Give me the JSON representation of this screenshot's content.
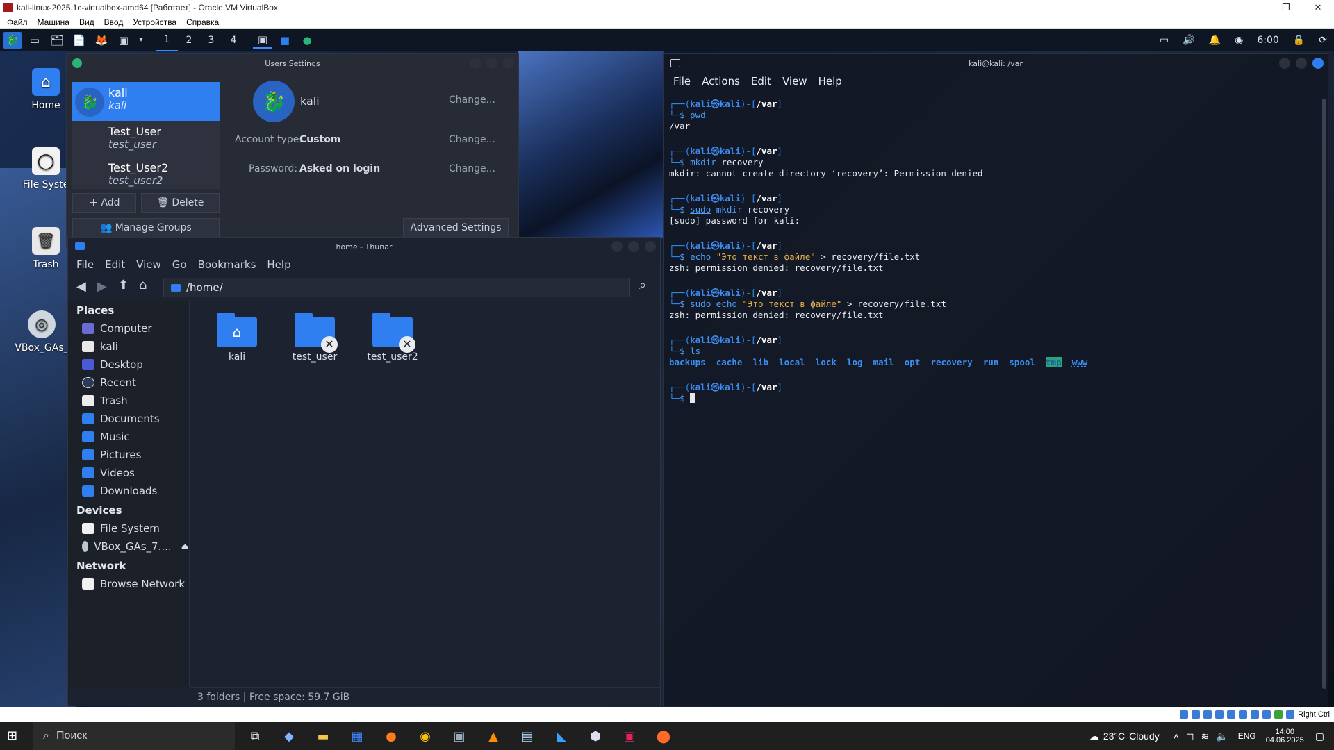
{
  "host": {
    "title": "kali-linux-2025.1c-virtualbox-amd64 [Работает] - Oracle VM VirtualBox",
    "menu": [
      "Файл",
      "Машина",
      "Вид",
      "Ввод",
      "Устройства",
      "Справка"
    ],
    "window_controls": [
      "—",
      "❐",
      "✕"
    ],
    "status_right": "Right Ctrl"
  },
  "panel": {
    "workspaces": [
      "1",
      "2",
      "3",
      "4"
    ],
    "clock": "6:00"
  },
  "desktop": {
    "icons": [
      "Home",
      "File Syste",
      "Trash",
      "VBox_GAs_"
    ]
  },
  "users": {
    "title": "Users Settings",
    "list": [
      {
        "name": "kali",
        "login": "kali"
      },
      {
        "name": "Test_User",
        "login": "test_user"
      },
      {
        "name": "Test_User2",
        "login": "test_user2"
      }
    ],
    "add_label": "Add",
    "delete_label": "Delete",
    "manage_groups_label": "Manage Groups",
    "advanced_label": "Advanced Settings",
    "selected_name": "kali",
    "account_type_label": "Account type:",
    "account_type_value": "Custom",
    "password_label": "Password:",
    "password_value": "Asked on login",
    "change_label": "Change..."
  },
  "thunar": {
    "title": "home - Thunar",
    "menu": [
      "File",
      "Edit",
      "View",
      "Go",
      "Bookmarks",
      "Help"
    ],
    "path": "/home/",
    "places_header": "Places",
    "places": [
      "Computer",
      "kali",
      "Desktop",
      "Recent",
      "Trash",
      "Documents",
      "Music",
      "Pictures",
      "Videos",
      "Downloads"
    ],
    "devices_header": "Devices",
    "devices": [
      "File System",
      "VBox_GAs_7...."
    ],
    "network_header": "Network",
    "network": [
      "Browse Network"
    ],
    "folders": [
      {
        "name": "kali",
        "locked": false
      },
      {
        "name": "test_user",
        "locked": true
      },
      {
        "name": "test_user2",
        "locked": true
      }
    ],
    "status": "3 folders  |  Free space: 59.7 GiB"
  },
  "terminal": {
    "title": "kali@kali: /var",
    "menu": [
      "File",
      "Actions",
      "Edit",
      "View",
      "Help"
    ],
    "prompt_user": "kali",
    "prompt_host": "kali",
    "prompt_dir": "/var",
    "blocks": [
      {
        "cmd": "pwd",
        "sudo": false,
        "out": "/var"
      },
      {
        "cmd": "mkdir recovery",
        "sudo": false,
        "out": "mkdir: cannot create directory ‘recovery’: Permission denied"
      },
      {
        "cmd": "mkdir recovery",
        "sudo": true,
        "out": "[sudo] password for kali:"
      },
      {
        "cmd": "echo \"Это текст в файле\" > recovery/file.txt",
        "sudo": false,
        "out": "zsh: permission denied: recovery/file.txt"
      },
      {
        "cmd": "echo \"Это текст в файле\" > recovery/file.txt",
        "sudo": true,
        "out": "zsh: permission denied: recovery/file.txt"
      },
      {
        "cmd": "ls",
        "sudo": false,
        "out": ""
      }
    ],
    "ls_entries": [
      "backups",
      "cache",
      "lib",
      "local",
      "lock",
      "log",
      "mail",
      "opt",
      "recovery",
      "run",
      "spool",
      "tmp",
      "www"
    ]
  },
  "taskbar": {
    "search_placeholder": "Поиск",
    "weather_temp": "23°C",
    "weather_desc": "Cloudy",
    "lang": "ENG",
    "time": "14:00",
    "date": "04.06.2025"
  }
}
